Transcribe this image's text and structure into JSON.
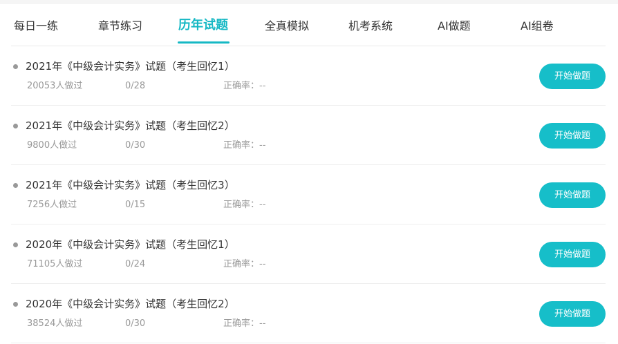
{
  "tabs": [
    {
      "label": "每日一练"
    },
    {
      "label": "章节练习"
    },
    {
      "label": "历年试题",
      "active": true
    },
    {
      "label": "全真模拟"
    },
    {
      "label": "机考系统"
    },
    {
      "label": "AI做题"
    },
    {
      "label": "AI组卷"
    }
  ],
  "exams": [
    {
      "title": "2021年《中级会计实务》试题（考生回忆1）",
      "count": "20053人做过",
      "progress": "0/28",
      "accuracy_label": "正确率：",
      "accuracy_value": "--",
      "button": "开始做题"
    },
    {
      "title": "2021年《中级会计实务》试题（考生回忆2）",
      "count": "9800人做过",
      "progress": "0/30",
      "accuracy_label": "正确率：",
      "accuracy_value": "--",
      "button": "开始做题"
    },
    {
      "title": "2021年《中级会计实务》试题（考生回忆3）",
      "count": "7256人做过",
      "progress": "0/15",
      "accuracy_label": "正确率：",
      "accuracy_value": "--",
      "button": "开始做题"
    },
    {
      "title": "2020年《中级会计实务》试题（考生回忆1）",
      "count": "71105人做过",
      "progress": "0/24",
      "accuracy_label": "正确率：",
      "accuracy_value": "--",
      "button": "开始做题"
    },
    {
      "title": "2020年《中级会计实务》试题（考生回忆2）",
      "count": "38524人做过",
      "progress": "0/30",
      "accuracy_label": "正确率：",
      "accuracy_value": "--",
      "button": "开始做题"
    }
  ],
  "colors": {
    "accent": "#16b8c4",
    "text": "#333333",
    "muted": "#999999"
  }
}
